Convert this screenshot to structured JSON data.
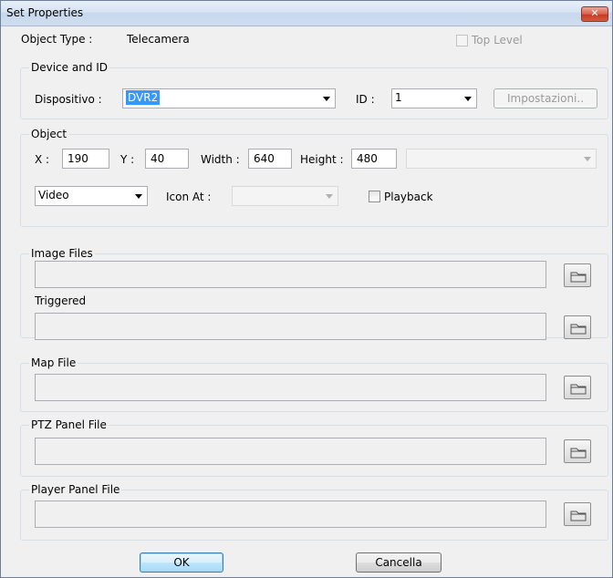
{
  "window": {
    "title": "Set Properties",
    "close_glyph": "✕"
  },
  "object_type": {
    "label": "Object Type :",
    "value": "Telecamera"
  },
  "top_level": {
    "label": "Top Level",
    "checked": false
  },
  "device_group": {
    "legend": "Device and ID",
    "device_label": "Dispositivo :",
    "device_value": "DVR2",
    "id_label": "ID :",
    "id_value": "1",
    "settings_button": "Impostazioni.."
  },
  "object_group": {
    "legend": "Object",
    "x_label": "X :",
    "x_value": "190",
    "y_label": "Y :",
    "y_value": "40",
    "width_label": "Width :",
    "width_value": "640",
    "height_label": "Height :",
    "height_value": "480",
    "type_value": "Video",
    "icon_at_label": "Icon At :",
    "icon_at_value": "",
    "playback_label": "Playback",
    "playback_checked": false
  },
  "image_files": {
    "legend": "Image Files",
    "triggered_label": "Triggered"
  },
  "map_file": {
    "legend": "Map File"
  },
  "ptz_panel": {
    "legend": "PTZ Panel File"
  },
  "player_panel": {
    "legend": "Player Panel File"
  },
  "buttons": {
    "ok": "OK",
    "cancel": "Cancella"
  },
  "icons": {
    "browse": "folder-icon",
    "dropdown": "chevron-down-icon"
  },
  "colors": {
    "selection": "#3399ff",
    "title_gradient_top": "#e7eef8",
    "close_red": "#c63b22"
  }
}
